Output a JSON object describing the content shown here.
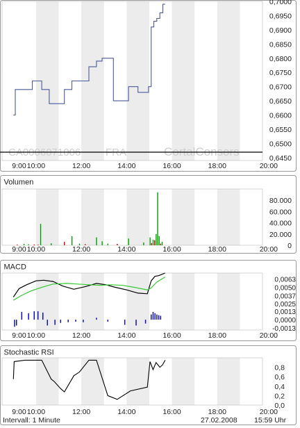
{
  "chart_data": [
    {
      "type": "line",
      "panel": "price",
      "title": "",
      "ylim": [
        0.644,
        0.7
      ],
      "y_ticks": [
        "0,7000",
        "0,6950",
        "0,6900",
        "0,6850",
        "0,6800",
        "0,6750",
        "0,6700",
        "0,6650",
        "0,6600",
        "0,6550",
        "0,6500",
        "0,6450"
      ],
      "x_ticks": [
        "9:00",
        "10:00",
        "12:00",
        "14:00",
        "16:00",
        "18:00",
        "20:00"
      ],
      "watermark_isin": "CA0006071006",
      "watermark_exchange": "FRA",
      "watermark_brand": "CortalConsors",
      "series": [
        {
          "x": [
            "09:00",
            "09:00",
            "09:05",
            "09:05",
            "09:50",
            "09:50",
            "10:00",
            "10:00",
            "10:15",
            "10:15",
            "10:35",
            "10:35",
            "11:00",
            "11:00",
            "11:15",
            "11:15",
            "11:35",
            "11:35",
            "11:55",
            "11:55",
            "12:20",
            "12:20",
            "12:40",
            "12:40",
            "12:55",
            "12:55",
            "13:10",
            "13:10",
            "13:25",
            "13:25",
            "13:45",
            "13:45",
            "14:05",
            "14:05",
            "14:30",
            "14:30",
            "14:50",
            "14:50",
            "14:58",
            "14:58",
            "15:05",
            "15:05",
            "15:12",
            "15:12",
            "15:20",
            "15:20",
            "15:28",
            "15:28",
            "15:36",
            "15:36",
            "15:42"
          ],
          "y": [
            0.66,
            0.66,
            0.66,
            0.669,
            0.669,
            0.672,
            0.672,
            0.672,
            0.672,
            0.669,
            0.669,
            0.664,
            0.664,
            0.664,
            0.664,
            0.669,
            0.669,
            0.672,
            0.672,
            0.672,
            0.672,
            0.677,
            0.677,
            0.679,
            0.679,
            0.68,
            0.68,
            0.68,
            0.68,
            0.665,
            0.665,
            0.665,
            0.665,
            0.67,
            0.67,
            0.668,
            0.668,
            0.668,
            0.668,
            0.67,
            0.67,
            0.691,
            0.691,
            0.693,
            0.693,
            0.694,
            0.694,
            0.696,
            0.696,
            0.699,
            0.699
          ]
        }
      ]
    },
    {
      "type": "bar",
      "panel": "volume",
      "title": "Volumen",
      "ylim": [
        0,
        100000
      ],
      "y_ticks": [
        "80.000",
        "60.000",
        "40.000",
        "20.000",
        "0"
      ],
      "x_ticks": [
        "9:00",
        "10:00",
        "12:00",
        "14:00",
        "16:00",
        "18:00",
        "20:00"
      ],
      "bars": [
        {
          "x": "09:10",
          "value": 1200,
          "color": "#cc0000"
        },
        {
          "x": "09:28",
          "value": 2500,
          "color": "#00a000"
        },
        {
          "x": "09:40",
          "value": 1800,
          "color": "#00a000"
        },
        {
          "x": "09:55",
          "value": 1400,
          "color": "#cc0000"
        },
        {
          "x": "10:05",
          "value": 1000,
          "color": "#cc0000"
        },
        {
          "x": "10:12",
          "value": 38000,
          "color": "#00a000"
        },
        {
          "x": "10:40",
          "value": 3500,
          "color": "#00a000"
        },
        {
          "x": "11:15",
          "value": 6000,
          "color": "#cc0000"
        },
        {
          "x": "11:35",
          "value": 16000,
          "color": "#00a000"
        },
        {
          "x": "11:55",
          "value": 3000,
          "color": "#00a000"
        },
        {
          "x": "12:10",
          "value": 2000,
          "color": "#cc0000"
        },
        {
          "x": "12:40",
          "value": 14000,
          "color": "#00a000"
        },
        {
          "x": "12:55",
          "value": 7000,
          "color": "#00a000"
        },
        {
          "x": "13:10",
          "value": 3000,
          "color": "#00a000"
        },
        {
          "x": "13:35",
          "value": 2500,
          "color": "#cc0000"
        },
        {
          "x": "14:05",
          "value": 12000,
          "color": "#00a000"
        },
        {
          "x": "14:45",
          "value": 5000,
          "color": "#00a000"
        },
        {
          "x": "15:02",
          "value": 14000,
          "color": "#00a000"
        },
        {
          "x": "15:06",
          "value": 4000,
          "color": "#cc0000"
        },
        {
          "x": "15:10",
          "value": 10000,
          "color": "#00a000"
        },
        {
          "x": "15:14",
          "value": 9000,
          "color": "#cc0000"
        },
        {
          "x": "15:18",
          "value": 20000,
          "color": "#00a000"
        },
        {
          "x": "15:22",
          "value": 94000,
          "color": "#00a000"
        },
        {
          "x": "15:26",
          "value": 16000,
          "color": "#00a000"
        },
        {
          "x": "15:30",
          "value": 3000,
          "color": "#cc0000"
        },
        {
          "x": "15:34",
          "value": 6000,
          "color": "#00a000"
        }
      ]
    },
    {
      "type": "line",
      "panel": "macd",
      "title": "MACD",
      "ylim": [
        -0.0016,
        0.0072
      ],
      "y_ticks": [
        {
          "label": "0,0063",
          "value": 0.0063
        },
        {
          "label": "0,0050",
          "value": 0.005
        },
        {
          "label": "0,0037",
          "value": 0.0037
        },
        {
          "label": "0,0025",
          "value": 0.0025
        },
        {
          "label": "0,0013",
          "value": 0.0013
        },
        {
          "label": "0,0000",
          "value": 0.0
        },
        {
          "label": "-0,0013",
          "value": -0.0013
        }
      ],
      "x_ticks": [
        "9:00",
        "10:00",
        "12:00",
        "14:00",
        "16:00",
        "18:00",
        "20:00"
      ],
      "series": [
        {
          "name": "",
          "color": "#000000",
          "x": [
            "09:00",
            "09:15",
            "09:35",
            "10:00",
            "10:20",
            "10:45",
            "11:10",
            "11:40",
            "12:10",
            "12:40",
            "13:05",
            "13:30",
            "14:00",
            "14:30",
            "14:55",
            "15:05",
            "15:15",
            "15:25",
            "15:42"
          ],
          "y": [
            0.0035,
            0.0048,
            0.0054,
            0.006,
            0.0061,
            0.0059,
            0.0052,
            0.0047,
            0.0051,
            0.0056,
            0.0054,
            0.005,
            0.0046,
            0.0041,
            0.004,
            0.006,
            0.0067,
            0.0068,
            0.0072
          ]
        },
        {
          "name": "",
          "color": "#33cc33",
          "x": [
            "09:00",
            "09:20",
            "09:45",
            "10:15",
            "10:45",
            "11:20",
            "11:50",
            "12:20",
            "12:50",
            "13:20",
            "13:50",
            "14:20",
            "14:55",
            "15:05",
            "15:20",
            "15:42"
          ],
          "y": [
            0.003,
            0.0037,
            0.0044,
            0.005,
            0.0055,
            0.0056,
            0.0055,
            0.0054,
            0.0053,
            0.0054,
            0.0053,
            0.005,
            0.0046,
            0.0049,
            0.0058,
            0.0066
          ]
        }
      ],
      "bars": [
        {
          "x": "09:03",
          "value": -0.0011
        },
        {
          "x": "09:08",
          "value": -0.0009
        },
        {
          "x": "09:22",
          "value": 0.0012
        },
        {
          "x": "09:40",
          "value": 0.001
        },
        {
          "x": "09:55",
          "value": 0.0013
        },
        {
          "x": "10:05",
          "value": 0.0013
        },
        {
          "x": "10:18",
          "value": 0.0011
        },
        {
          "x": "10:30",
          "value": -0.0009
        },
        {
          "x": "10:50",
          "value": -0.0008
        },
        {
          "x": "11:05",
          "value": -0.0005
        },
        {
          "x": "11:25",
          "value": -0.0004
        },
        {
          "x": "11:45",
          "value": -0.0003
        },
        {
          "x": "12:05",
          "value": -0.0004
        },
        {
          "x": "12:40",
          "value": 0.0003
        },
        {
          "x": "13:10",
          "value": -0.0003
        },
        {
          "x": "13:55",
          "value": -0.0008
        },
        {
          "x": "14:25",
          "value": -0.0009
        },
        {
          "x": "14:50",
          "value": -0.0006
        },
        {
          "x": "15:05",
          "value": 0.0008
        },
        {
          "x": "15:10",
          "value": 0.0012
        },
        {
          "x": "15:15",
          "value": 0.001
        },
        {
          "x": "15:20",
          "value": 0.0008
        },
        {
          "x": "15:25",
          "value": 0.0007
        },
        {
          "x": "15:30",
          "value": 0.0006
        }
      ]
    },
    {
      "type": "line",
      "panel": "stochastic_rsi",
      "title": "Stochastic RSI",
      "ylim": [
        0,
        1
      ],
      "y_ticks": [
        {
          "label": "0,8",
          "value": 0.8
        },
        {
          "label": "0,6",
          "value": 0.6
        },
        {
          "label": "0,4",
          "value": 0.4
        },
        {
          "label": "0,2",
          "value": 0.2
        },
        {
          "label": "0,0",
          "value": 0.0
        }
      ],
      "x_ticks": [
        "9:00",
        "10:00",
        "12:00",
        "14:00",
        "16:00",
        "18:00",
        "20:00"
      ],
      "series": [
        {
          "name": "",
          "color": "#000000",
          "x": [
            "09:00",
            "09:02",
            "09:30",
            "10:00",
            "10:15",
            "10:40",
            "10:48",
            "11:05",
            "11:15",
            "11:40",
            "11:55",
            "12:20",
            "12:40",
            "13:10",
            "13:35",
            "14:10",
            "14:55",
            "15:02",
            "15:10",
            "15:18",
            "15:28",
            "15:35",
            "15:42"
          ],
          "y": [
            0.55,
            0.92,
            0.95,
            0.95,
            0.95,
            0.55,
            0.5,
            0.35,
            0.28,
            0.62,
            0.7,
            0.95,
            0.95,
            0.2,
            0.12,
            0.3,
            0.38,
            0.92,
            0.75,
            0.9,
            0.8,
            0.85,
            0.95
          ]
        }
      ]
    }
  ],
  "footer": {
    "interval": "Intervall: 1 Minute",
    "date": "27.02.2008",
    "time": "15:59 Uhr"
  }
}
